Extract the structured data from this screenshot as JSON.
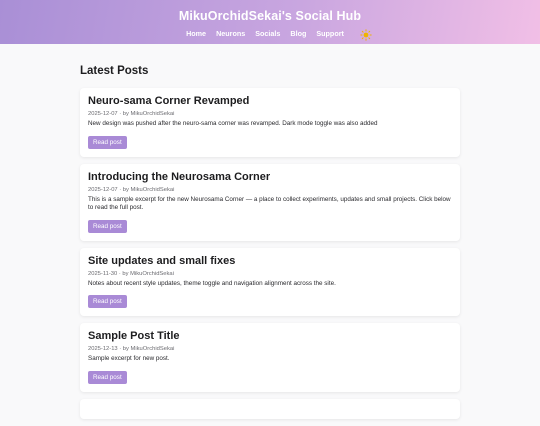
{
  "header": {
    "title": "MikuOrchidSekai's Social Hub",
    "nav": [
      {
        "label": "Home"
      },
      {
        "label": "Neurons"
      },
      {
        "label": "Socials"
      },
      {
        "label": "Blog"
      },
      {
        "label": "Support"
      }
    ],
    "theme_toggle_icon": "sun-icon",
    "accent_gradient": [
      "#a98fd6",
      "#f1bfe6"
    ]
  },
  "main": {
    "section_title": "Latest Posts",
    "posts": [
      {
        "title": "Neuro-sama Corner Revamped",
        "meta": "2025-12-07 · by MikuOrchidSekai",
        "excerpt": "New design was pushed after the neuro-sama corner was revamped. Dark mode toggle was also added",
        "button": "Read post"
      },
      {
        "title": "Introducing the Neurosama Corner",
        "meta": "2025-12-07 · by MikuOrchidSekai",
        "excerpt": "This is a sample excerpt for the new Neurosama Corner — a place to collect experiments, updates and small projects. Click below to read the full post.",
        "button": "Read post"
      },
      {
        "title": "Site updates and small fixes",
        "meta": "2025-11-30 · by MikuOrchidSekai",
        "excerpt": "Notes about recent style updates, theme toggle and navigation alignment across the site.",
        "button": "Read post"
      },
      {
        "title": "Sample Post Title",
        "meta": "2025-12-13 · by MikuOrchidSekai",
        "excerpt": "Sample excerpt for new post.",
        "button": "Read post"
      }
    ],
    "button_color": "#a98ad6"
  }
}
